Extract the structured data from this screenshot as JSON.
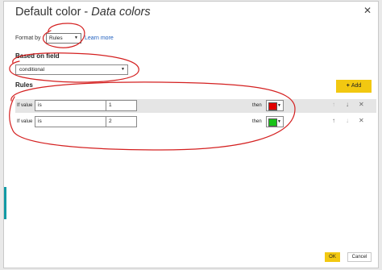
{
  "dialog": {
    "title_main": "Default color - ",
    "title_italic": "Data colors",
    "close_glyph": "✕"
  },
  "format_by": {
    "label": "Format by",
    "value": "Rules",
    "link": "Learn more"
  },
  "based_on_field": {
    "label": "Based on field",
    "value": "conditional"
  },
  "rules": {
    "label": "Rules",
    "add_label": "Add",
    "rows": [
      {
        "if_label": "If value",
        "operator": "is",
        "value": "1",
        "then_label": "then",
        "color": "#e00000"
      },
      {
        "if_label": "If value",
        "operator": "is",
        "value": "2",
        "then_label": "then",
        "color": "#19c219"
      }
    ]
  },
  "icons": {
    "up": "↑",
    "down": "↓",
    "delete": "✕",
    "caret": "▼"
  },
  "footer": {
    "ok_label": "OK",
    "cancel_label": "Cancel"
  },
  "annotation_color": "#d42020"
}
